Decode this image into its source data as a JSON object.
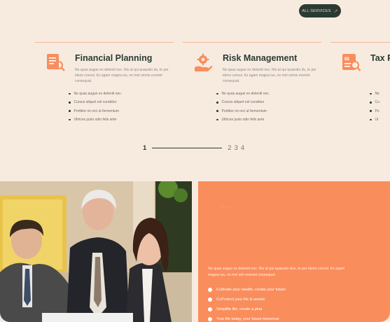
{
  "header": {
    "all_services_label": "ALL SERVICES",
    "all_services_icon": "arrow-up-right-icon"
  },
  "services": [
    {
      "title": "Financial Planning",
      "icon": "document-magnifier-icon",
      "description": "Ne quas augue ex deleniti nec. Nis at qui quaestio du, te per idens consul. Ex agam magna ius, ne mel omnis eveniet consequat.",
      "bullets": [
        "Ne quas augue ex deleniti nec.",
        "Cursus aliquet est curabitur",
        "Porttitor mi orci ut fermentum",
        "Ultrices justo odio felis ante"
      ]
    },
    {
      "title": "Risk Management",
      "icon": "gear-hand-icon",
      "description": "Ne quas augue ex deleniti nec. Nis at qui quaestio du, te per idens consul. Ex agam magna ius, ne mel omnis eveniet consequat.",
      "bullets": [
        "Ne quas augue ex deleniti nec.",
        "Cursus aliquet est curabitur",
        "Porttitor mi orci ut fermentum",
        "Ultrices justo odio felis ante"
      ]
    },
    {
      "title": "Tax P",
      "icon": "tax-document-icon",
      "description": "",
      "bullets": [
        "Ne",
        "Cu",
        "Po",
        "Ul"
      ]
    }
  ],
  "pagination": {
    "current": "1",
    "pages": [
      "2",
      "3",
      "4"
    ]
  },
  "promo": {
    "faded_text": "——",
    "paragraph": "Ne quas augue ex deleniti nec. Nis at qui quaestio duo, te per idens consul. Ex agam magna ius, ne mel sim eveniet consequat.",
    "bullets": [
      "Cultivate your wealth, create your future",
      "CuProtect your life & assets",
      "Simplifie life, create a plna",
      "Your life today, your future tomorrow"
    ]
  },
  "colors": {
    "accent": "#fa8d5c",
    "dark": "#2a3b33",
    "background": "#f7ebe0"
  }
}
